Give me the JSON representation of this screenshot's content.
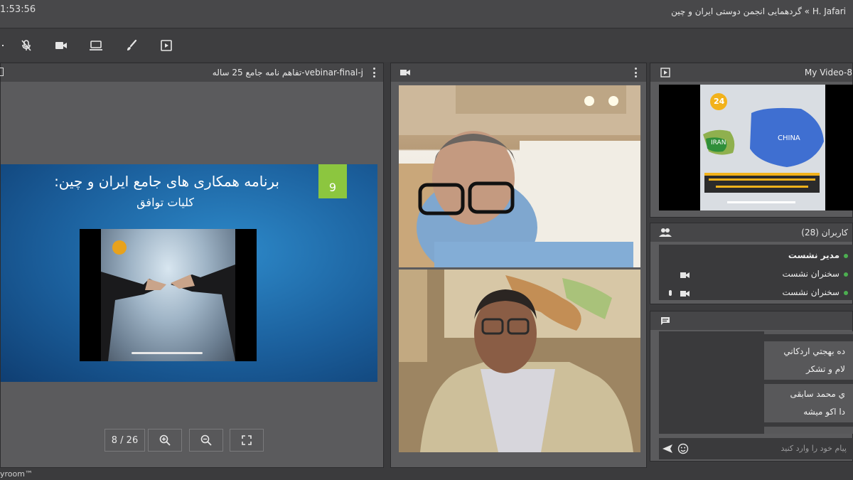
{
  "topbar": {
    "clock": "1:53:56",
    "room_title": "H. Jafari » گردهمایی انجمن دوستی ایران و چین"
  },
  "toolbar": {
    "icons": [
      "mic-off-icon",
      "camera-icon",
      "screen-share-icon",
      "brush-icon",
      "media-play-icon"
    ]
  },
  "presentation": {
    "file_title": "تفاهم نامه جامع 25 ساله-vebinar-final-j",
    "slide": {
      "title": "برنامه همکاری های جامع ایران و چین:",
      "subtitle": "کلیات توافق",
      "number": "9"
    },
    "pager": {
      "page": "8 / 26"
    }
  },
  "my_video": {
    "title": "My Video-8",
    "map_labels": {
      "iran": "IRAN",
      "china": "CHINA",
      "logo": "24"
    }
  },
  "users": {
    "title": "کاربران (28)",
    "rows": [
      "مدیر نشست",
      "سخنران نشست",
      "سخنران نشست"
    ]
  },
  "chat": {
    "messages": [
      {
        "name": "ده بهجتي اردكاني",
        "text": "لام و تشكر"
      },
      {
        "name": "ي محمد سابقى",
        "text": "دا اكو ميشه"
      }
    ],
    "placeholder": "پیام خود را وارد کنید"
  },
  "footer": {
    "brand": "yroom™"
  },
  "colors": {
    "slide_number_bg": "#8cc63f",
    "presence_online": "#4caf50",
    "slide_bg": "#1b5f9c"
  }
}
